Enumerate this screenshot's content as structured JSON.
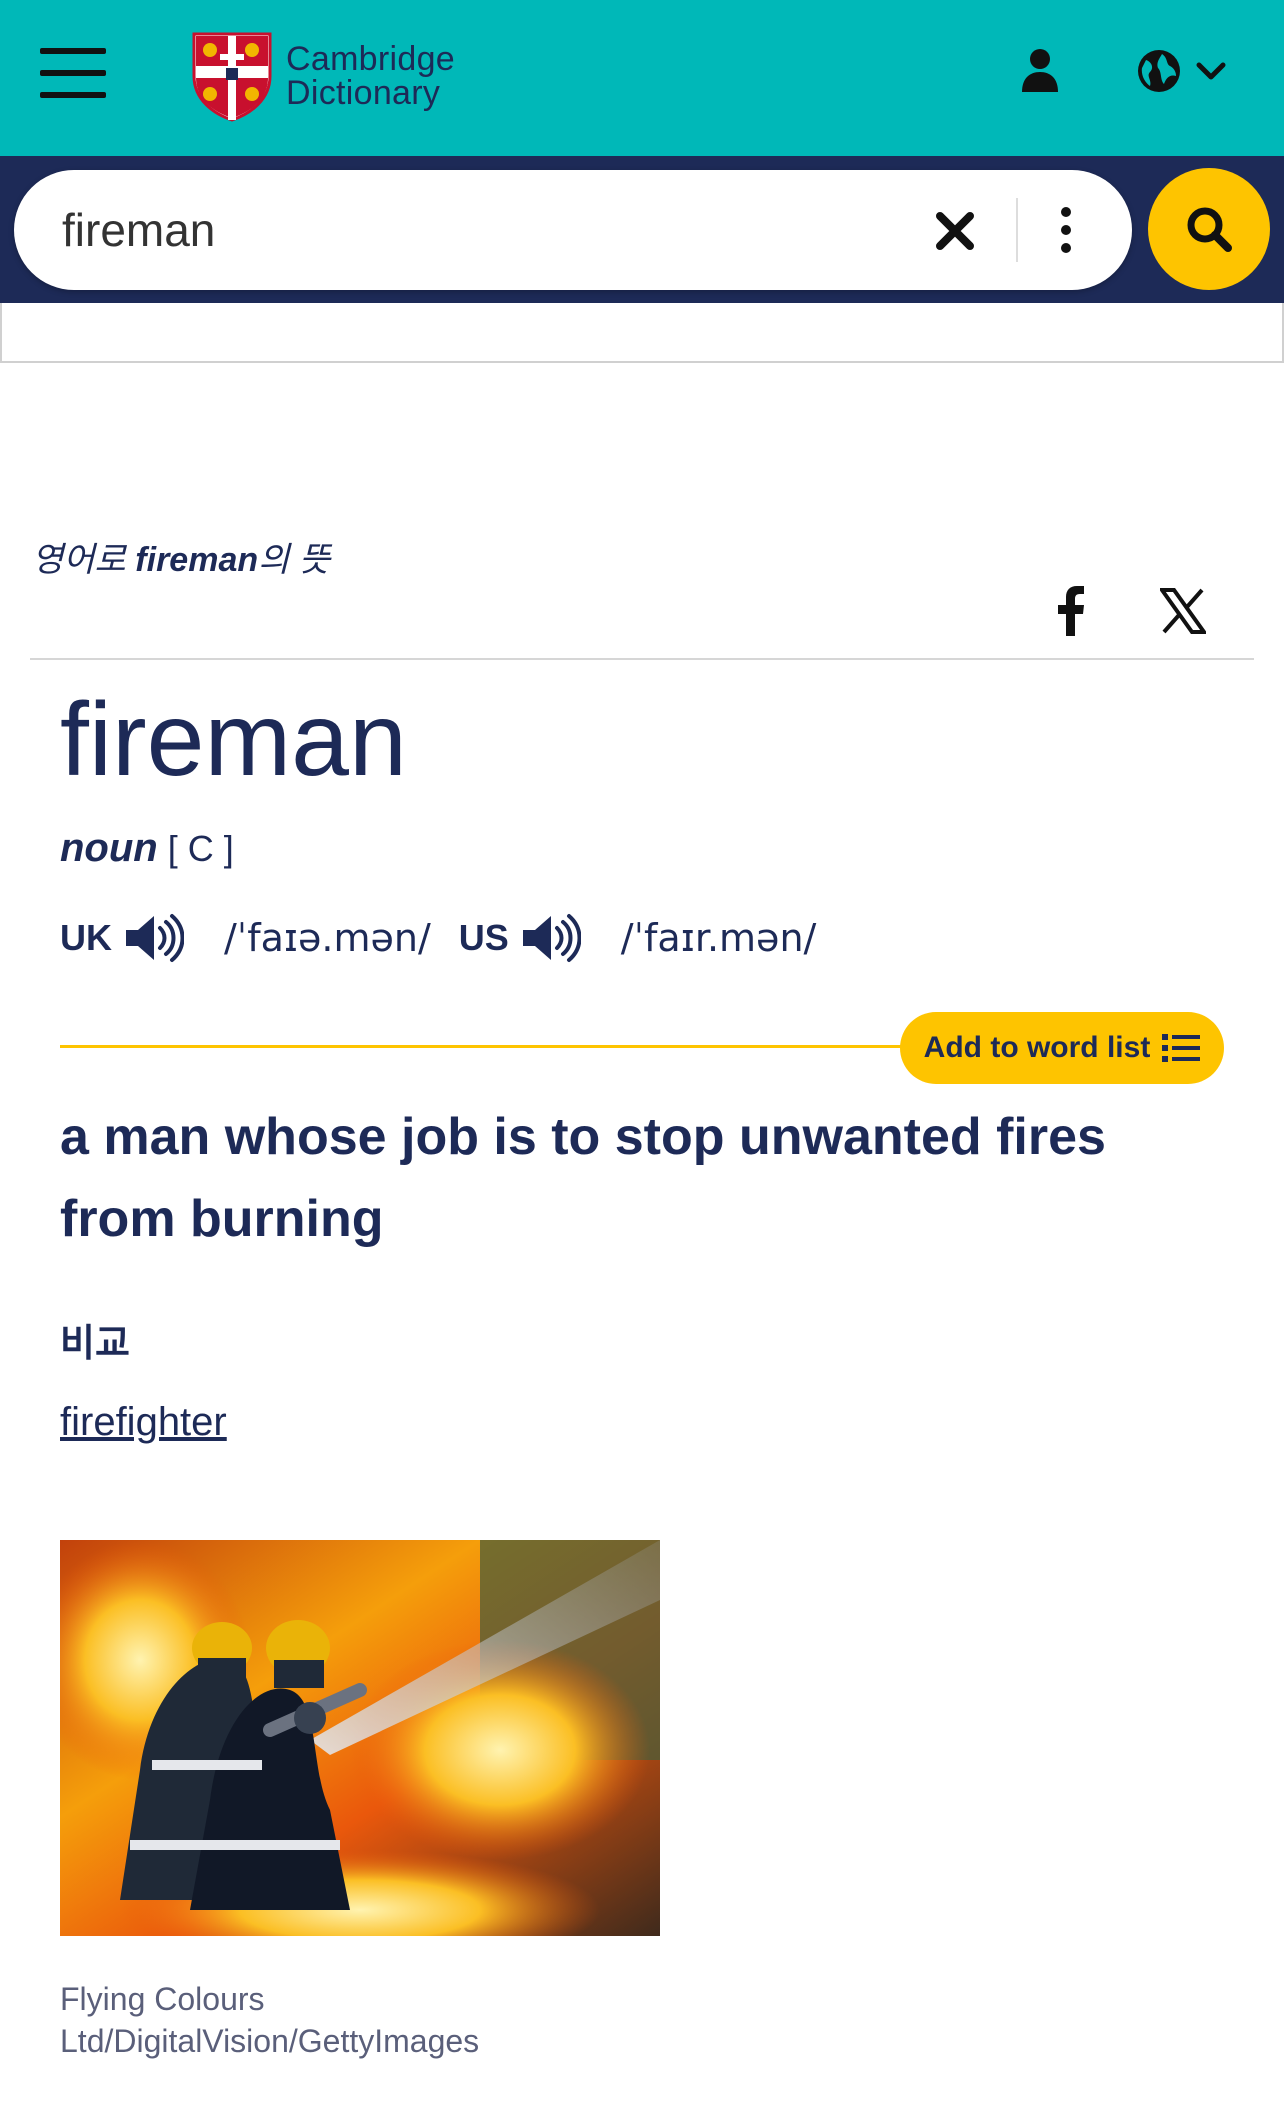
{
  "header": {
    "logo_line1": "Cambridge",
    "logo_line2": "Dictionary",
    "bg_color": "#00b8b8",
    "icons": [
      "menu-icon",
      "user-icon",
      "globe-icon",
      "chevron-down-icon"
    ]
  },
  "search": {
    "value": "fireman",
    "icons": [
      "close-icon",
      "more-vertical-icon",
      "search-icon"
    ],
    "band_color": "#1d2a57",
    "button_color": "#fec400"
  },
  "entry": {
    "meaning_prefix": "영어로 ",
    "meaning_word": "fireman",
    "meaning_suffix": "의 뜻",
    "share_icons": [
      "facebook-icon",
      "x-icon"
    ],
    "headword": "fireman",
    "pos": "noun",
    "grammar": "[ C ]",
    "pron_uk_label": "UK",
    "pron_uk_ipa": "/ˈfaɪə.mən/",
    "pron_us_label": "US",
    "pron_us_ipa": "/ˈfaɪr.mən/",
    "add_to_word_list": "Add to word list",
    "definition": "a man whose job is to stop unwanted fires from burning",
    "compare_label": "비교",
    "compare_link": "firefighter",
    "image_credit": "Flying Colours Ltd/DigitalVision/GettyImages"
  }
}
